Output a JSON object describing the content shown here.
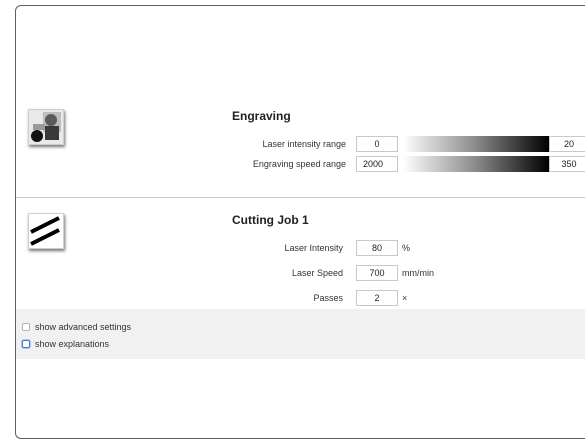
{
  "engraving": {
    "title": "Engraving",
    "intensity_label": "Laser intensity range",
    "intensity_min": "0",
    "intensity_max": "20",
    "speed_label": "Engraving speed range",
    "speed_min": "2000",
    "speed_max": "350",
    "icon": "engraving-photo-icon"
  },
  "cutting": {
    "title": "Cutting Job 1",
    "intensity_label": "Laser Intensity",
    "intensity_value": "80",
    "intensity_unit": "%",
    "speed_label": "Laser Speed",
    "speed_value": "700",
    "speed_unit": "mm/min",
    "passes_label": "Passes",
    "passes_value": "2",
    "passes_unit": "×",
    "icon": "cut-lines-icon"
  },
  "options": {
    "advanced_label": "show advanced settings",
    "explanations_label": "show explanations"
  },
  "colors": {
    "border": "#5f5f5f",
    "footer_bg": "#f1f1f1",
    "focus": "#3a7bd5"
  }
}
